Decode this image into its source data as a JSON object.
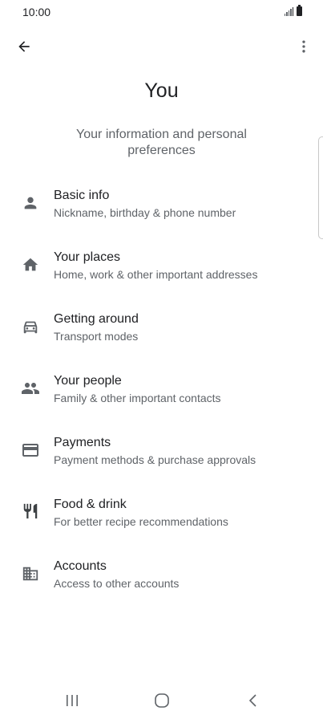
{
  "status_bar": {
    "time": "10:00"
  },
  "app_bar": {
    "back_icon": "arrow-back-icon",
    "more_icon": "more-vert-icon"
  },
  "header": {
    "title": "You",
    "subtitle": "Your information and personal preferences"
  },
  "menu": {
    "items": [
      {
        "icon": "person-icon",
        "title": "Basic info",
        "description": "Nickname, birthday & phone number"
      },
      {
        "icon": "home-icon",
        "title": "Your places",
        "description": "Home, work & other important addresses"
      },
      {
        "icon": "car-icon",
        "title": "Getting around",
        "description": "Transport modes"
      },
      {
        "icon": "people-icon",
        "title": "Your people",
        "description": "Family & other important contacts"
      },
      {
        "icon": "credit-card-icon",
        "title": "Payments",
        "description": "Payment methods & purchase approvals"
      },
      {
        "icon": "restaurant-icon",
        "title": "Food & drink",
        "description": "For better recipe recommendations"
      },
      {
        "icon": "building-icon",
        "title": "Accounts",
        "description": "Access to other accounts"
      }
    ]
  },
  "nav_bar": {
    "recents_icon": "recents-icon",
    "home_icon": "home-button-icon",
    "back_icon": "nav-back-icon"
  },
  "colors": {
    "primary_text": "#202124",
    "secondary_text": "#5f6368",
    "icon": "#5f6368",
    "background": "#ffffff"
  }
}
